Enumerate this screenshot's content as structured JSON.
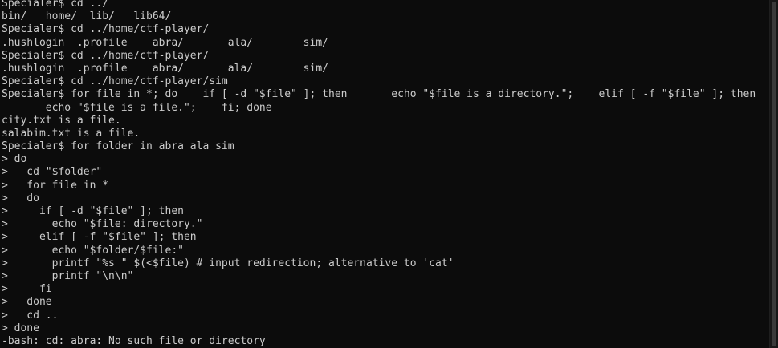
{
  "terminal": {
    "lines": [
      "Specialer$ cd ../",
      "bin/   home/  lib/   lib64/",
      "Specialer$ cd ../home/ctf-player/",
      ".hushlogin  .profile    abra/       ala/        sim/",
      "Specialer$ cd ../home/ctf-player/",
      ".hushlogin  .profile    abra/       ala/        sim/",
      "Specialer$ cd ../home/ctf-player/sim",
      "Specialer$ for file in *; do    if [ -d \"$file\" ]; then       echo \"$file is a directory.\";    elif [ -f \"$file\" ]; then",
      "       echo \"$file is a file.\";    fi; done",
      "city.txt is a file.",
      "salabim.txt is a file.",
      "Specialer$ for folder in abra ala sim",
      "> do",
      ">   cd \"$folder\"",
      ">   for file in *",
      ">   do",
      ">     if [ -d \"$file\" ]; then",
      ">       echo \"$file: directory.\"",
      ">     elif [ -f \"$file\" ]; then",
      ">       echo \"$folder/$file:\"",
      ">       printf \"%s \" $(<$file) # input redirection; alternative to 'cat'",
      ">       printf \"\\n\\n\"",
      ">     fi",
      ">   done",
      ">   cd ..",
      "> done",
      "-bash: cd: abra: No such file or directory"
    ]
  }
}
